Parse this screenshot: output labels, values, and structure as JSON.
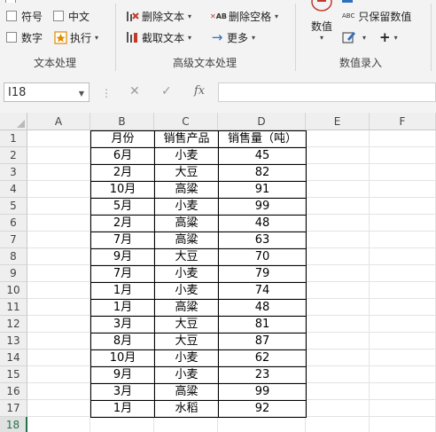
{
  "ribbon": {
    "text_group": {
      "label": "文本处理",
      "options": [
        {
          "label": "符号"
        },
        {
          "label": "中文"
        },
        {
          "label": "数字"
        }
      ],
      "execute_label": "执行"
    },
    "advanced_group": {
      "label": "高级文本处理",
      "delete_text_label": "删除文本",
      "delete_space_label": "删除空格",
      "extract_text_label": "截取文本",
      "more_label": "更多",
      "ab_glyph": "AB"
    },
    "value_group": {
      "label": "数值录入",
      "value_button_label": "数值",
      "keep_value_label": "只保留数值",
      "abc_glyph": "ABC"
    }
  },
  "formula_bar": {
    "name_box": "I18",
    "formula": ""
  },
  "grid": {
    "columns": [
      "A",
      "B",
      "C",
      "D",
      "E",
      "F"
    ],
    "rows": [
      "1",
      "2",
      "3",
      "4",
      "5",
      "6",
      "7",
      "8",
      "9",
      "10",
      "11",
      "12",
      "13",
      "14",
      "15",
      "16",
      "17",
      "18"
    ],
    "active_row": "18"
  },
  "table": {
    "headers": [
      "月份",
      "销售产品",
      "销售量（吨）"
    ],
    "rows": [
      [
        "6月",
        "小麦",
        "45"
      ],
      [
        "2月",
        "大豆",
        "82"
      ],
      [
        "10月",
        "高粱",
        "91"
      ],
      [
        "5月",
        "小麦",
        "99"
      ],
      [
        "2月",
        "高粱",
        "48"
      ],
      [
        "7月",
        "高粱",
        "63"
      ],
      [
        "9月",
        "大豆",
        "70"
      ],
      [
        "7月",
        "小麦",
        "79"
      ],
      [
        "1月",
        "小麦",
        "74"
      ],
      [
        "1月",
        "高粱",
        "48"
      ],
      [
        "3月",
        "大豆",
        "81"
      ],
      [
        "8月",
        "大豆",
        "87"
      ],
      [
        "10月",
        "小麦",
        "62"
      ],
      [
        "9月",
        "小麦",
        "23"
      ],
      [
        "3月",
        "高粱",
        "99"
      ],
      [
        "1月",
        "水稻",
        "92"
      ]
    ]
  },
  "colors": {
    "accent_green": "#217346",
    "ribbon_bg": "#f3f3f3",
    "icon_red": "#c0392b",
    "icon_blue": "#2f6fbf"
  }
}
